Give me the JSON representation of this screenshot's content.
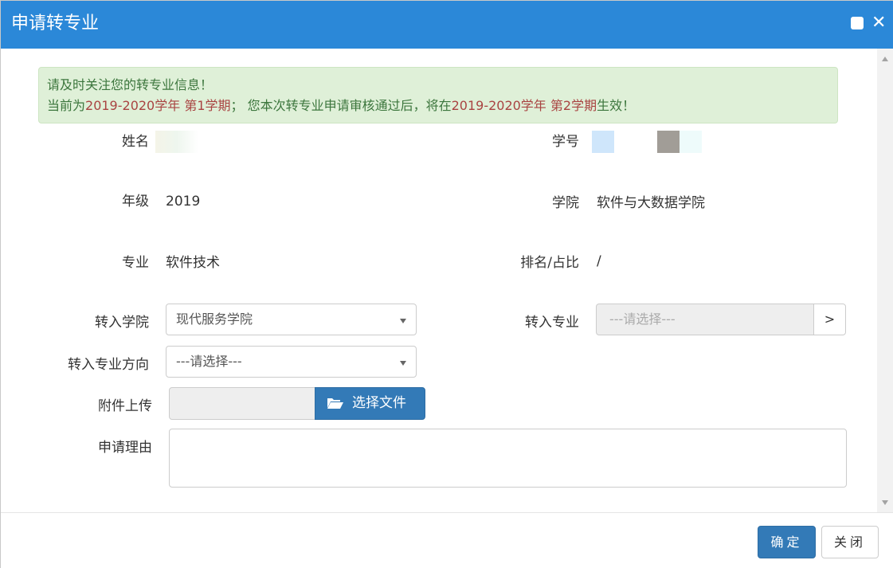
{
  "window": {
    "title": "申请转专业"
  },
  "alert": {
    "line1": "请及时关注您的转专业信息！",
    "line2_a": "当前为",
    "line2_b": "2019-2020学年 第1学期",
    "line2_c": "；  您本次转专业申请审核通过后，将在",
    "line2_d": "2019-2020学年 第2学期",
    "line2_e": "生效！"
  },
  "info": {
    "name_label": "姓名",
    "student_id_label": "学号",
    "grade_label": "年级",
    "grade_value": "2019",
    "college_label": "学院",
    "college_value": "软件与大数据学院",
    "major_label": "专业",
    "major_value": "软件技术",
    "rank_label": "排名/占比",
    "rank_value": "/"
  },
  "form": {
    "target_college_label": "转入学院",
    "target_college_value": "现代服务学院",
    "target_major_label": "转入专业",
    "target_major_placeholder": "---请选择---",
    "target_major_button": ">",
    "target_direction_label": "转入专业方向",
    "target_direction_value": "---请选择---",
    "attachment_label": "附件上传",
    "attachment_button": "选择文件",
    "reason_label": "申请理由"
  },
  "footer": {
    "confirm_label": "确定",
    "close_label": "关闭"
  },
  "colors": {
    "header": "#2b88d8",
    "primary": "#337ab7",
    "alert_bg": "#dff0d8",
    "alert_text": "#3c763d",
    "alert_highlight": "#a94442"
  }
}
